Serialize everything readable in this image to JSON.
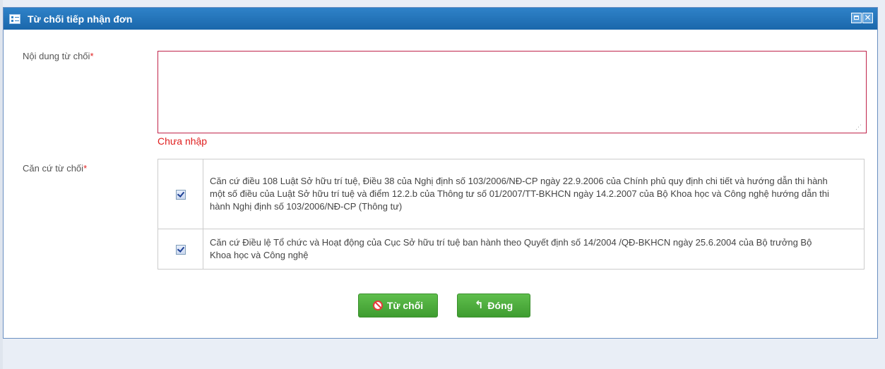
{
  "dialog": {
    "title": "Từ chối tiếp nhận đơn",
    "restore_icon": "restore-icon",
    "close_glyph": "✕"
  },
  "form": {
    "reason_label": "Nội dung từ chối",
    "required_mark": "*",
    "reason_value": "",
    "reason_error": "Chưa nhập",
    "basis_label": "Căn cứ từ chối",
    "basis_items": [
      {
        "checked": true,
        "text": "Căn cứ điều 108 Luật Sở hữu trí tuệ, Điều 38 của Nghị định số 103/2006/NĐ-CP ngày 22.9.2006 của Chính phủ quy định chi tiết và hướng dẫn thi hành một số điều của Luật Sở hữu trí tuệ và điểm 12.2.b của Thông tư số 01/2007/TT-BKHCN ngày 14.2.2007 của Bộ Khoa học và Công nghệ hướng dẫn thi hành Nghị định số 103/2006/NĐ-CP (Thông tư)"
      },
      {
        "checked": true,
        "text": "Căn cứ Điều lệ Tổ chức và Hoạt động của Cục Sở hữu trí tuệ ban hành theo Quyết định số 14/2004 /QĐ-BKHCN ngày 25.6.2004 của Bộ trưởng Bộ Khoa học và Công nghệ"
      }
    ]
  },
  "actions": {
    "reject_label": "Từ chối",
    "close_label": "Đóng"
  },
  "colors": {
    "titlebar": "#1f72b9",
    "error": "#e02020",
    "button_green": "#4aad3b"
  }
}
